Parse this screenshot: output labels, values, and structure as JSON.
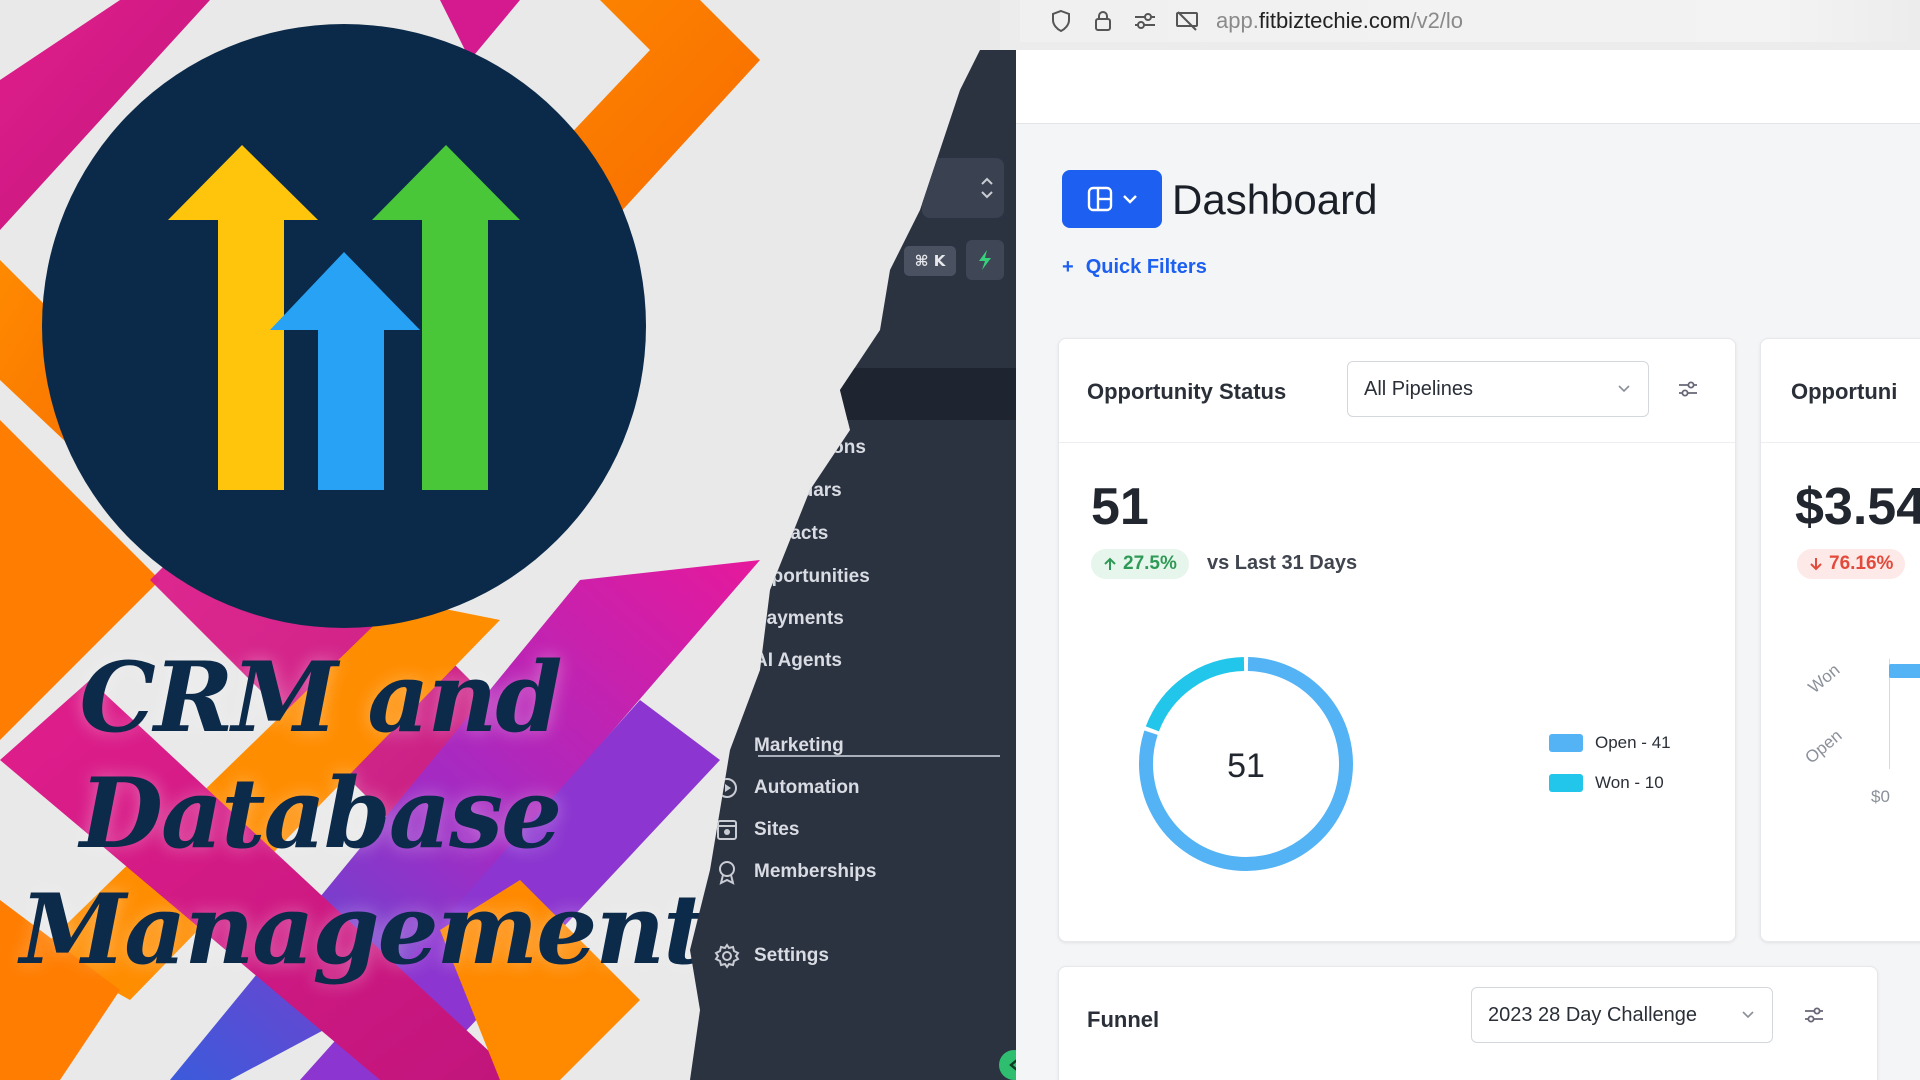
{
  "promo": {
    "title_lines": [
      "CRM and",
      "Database",
      "Management"
    ],
    "logo": "highlevel-arrows-logo"
  },
  "browser": {
    "url_prefix": "app.",
    "url_domain": "fitbiztechie.com",
    "url_path": "/v2/lo"
  },
  "sidebar": {
    "search_shortcut": "⌘ K",
    "items": [
      {
        "label": "ations",
        "icon": "chat-icon"
      },
      {
        "label": "ndars",
        "icon": "calendar-icon"
      },
      {
        "label": "tacts",
        "icon": "contacts-icon"
      },
      {
        "label": "pportunities",
        "icon": "funnel-icon"
      },
      {
        "label": "Payments",
        "icon": "payments-icon"
      },
      {
        "label": "AI Agents",
        "icon": "robot-icon"
      }
    ],
    "items2": [
      {
        "label": "Marketing",
        "icon": "megaphone-icon"
      },
      {
        "label": "Automation",
        "icon": "automation-icon"
      },
      {
        "label": "Sites",
        "icon": "sites-icon"
      },
      {
        "label": "Memberships",
        "icon": "badge-icon"
      },
      {
        "label": "Settings",
        "icon": "gear-icon"
      }
    ]
  },
  "header": {
    "title": "Dashboard",
    "quick_filters": "Quick Filters"
  },
  "opportunity_status": {
    "title": "Opportunity Status",
    "pipeline_select": "All Pipelines",
    "total": "51",
    "change": "27.5%",
    "vs_text": "vs Last 31 Days",
    "donut_center": "51",
    "legend": [
      {
        "label": "Open - 41",
        "color": "#53b3f5"
      },
      {
        "label": "Won - 10",
        "color": "#22c6ea"
      }
    ]
  },
  "opportunity_value": {
    "title": "Opportuni",
    "total": "$3.54",
    "change": "76.16%",
    "axis_labels": [
      "Won",
      "Open"
    ],
    "x_label": "$0"
  },
  "funnel": {
    "title": "Funnel",
    "select": "2023 28 Day Challenge"
  },
  "chart_data": {
    "type": "pie",
    "categories": [
      "Open",
      "Won"
    ],
    "values": [
      41,
      10
    ],
    "colors": [
      "#53b3f5",
      "#22c6ea"
    ],
    "title": "",
    "center_label": "51"
  }
}
